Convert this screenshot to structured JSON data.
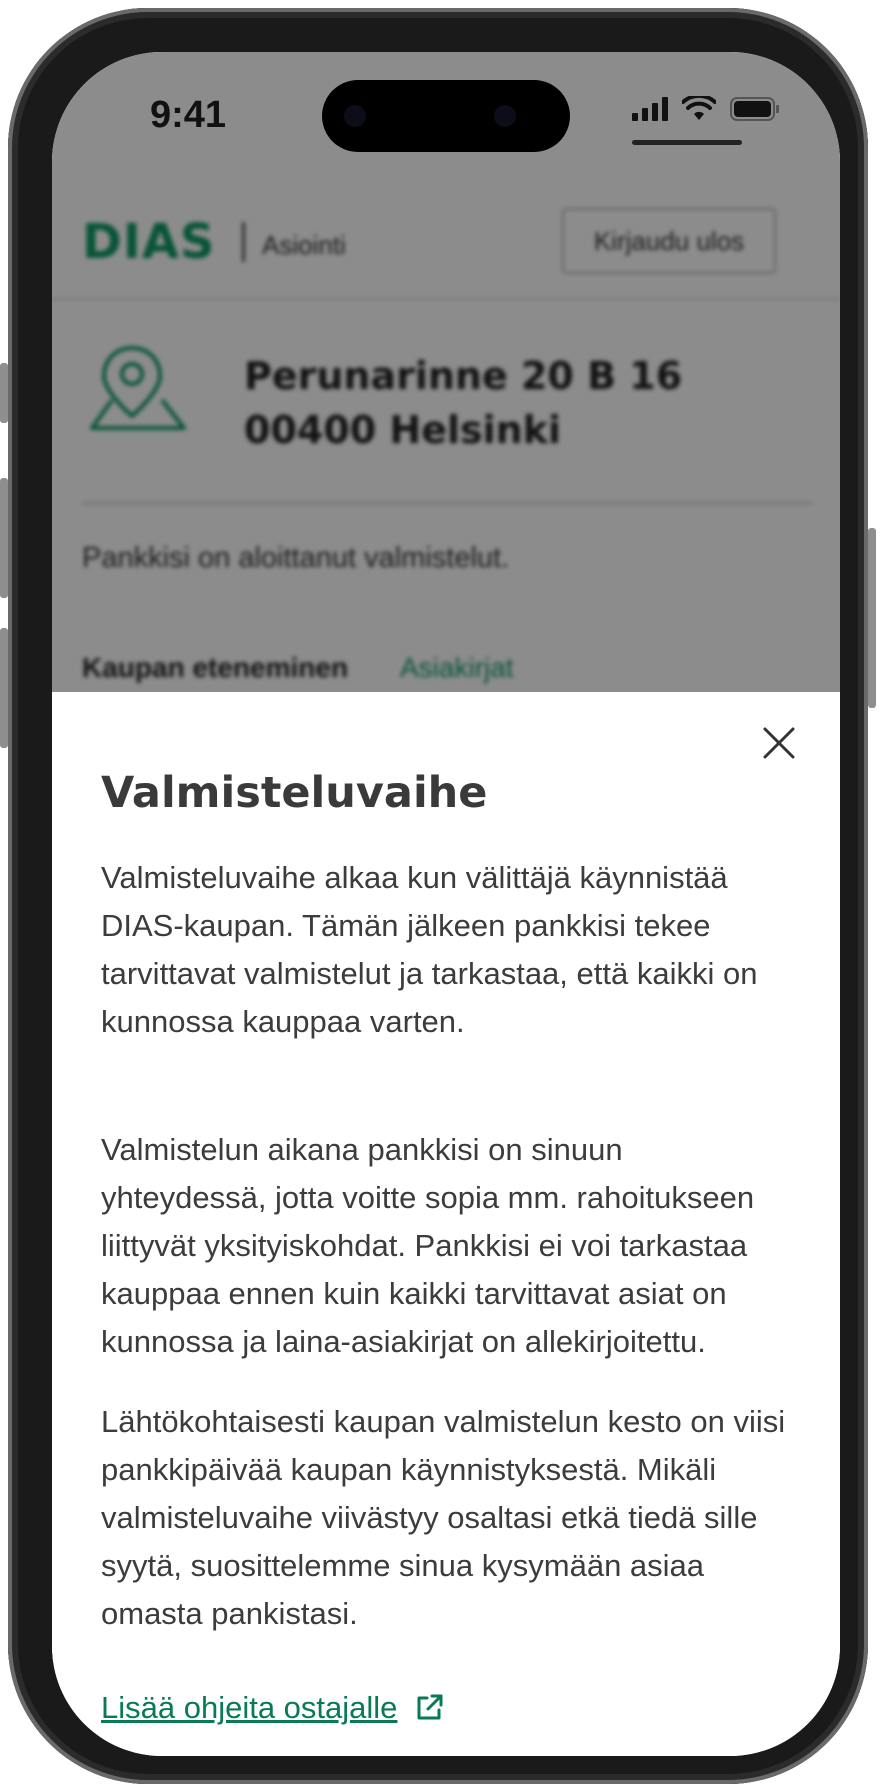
{
  "status_bar": {
    "time": "9:41"
  },
  "header": {
    "logo": "DIAS",
    "subtitle": "Asiointi",
    "logout_label": "Kirjaudu ulos"
  },
  "property": {
    "address_line1": "Perunarinne 20 B 16",
    "address_line2": "00400 Helsinki"
  },
  "status_text": "Pankkisi on aloittanut valmistelut.",
  "tabs": [
    {
      "label": "Kaupan eteneminen",
      "active": true
    },
    {
      "label": "Asiakirjat",
      "active": false
    }
  ],
  "sheet": {
    "title": "Valmisteluvaihe",
    "paragraphs": [
      "Valmisteluvaihe alkaa kun välittäjä käynnistää DIAS-kaupan. Tämän jälkeen pankkisi tekee tarvittavat valmistelut ja tarkastaa, että kaikki on kunnossa kauppaa varten.",
      "Valmistelun aikana pankkisi on sinuun yhteydessä, jotta voitte sopia mm. rahoitukseen liittyvät yksityiskohdat. Pankkisi ei voi tarkastaa kauppaa ennen kuin kaikki tarvittavat asiat on kunnossa ja laina-asiakirjat on allekirjoitettu.",
      "Lähtökohtaisesti kaupan valmistelun kesto on viisi pankkipäivää kaupan käynnistyksestä. Mikäli valmisteluvaihe viivästyy osaltasi etkä tiedä sille syytä, suosittelemme sinua kysymään asiaa omasta pankistasi."
    ],
    "link_label": "Lisää ohjeita ostajalle"
  },
  "colors": {
    "brand_green": "#0f9a66",
    "link_green": "#0a7a55",
    "text": "#3c3c3c"
  },
  "icons": [
    "location-pin-icon",
    "close-icon",
    "external-link-icon",
    "signal-icon",
    "wifi-icon",
    "battery-icon"
  ]
}
